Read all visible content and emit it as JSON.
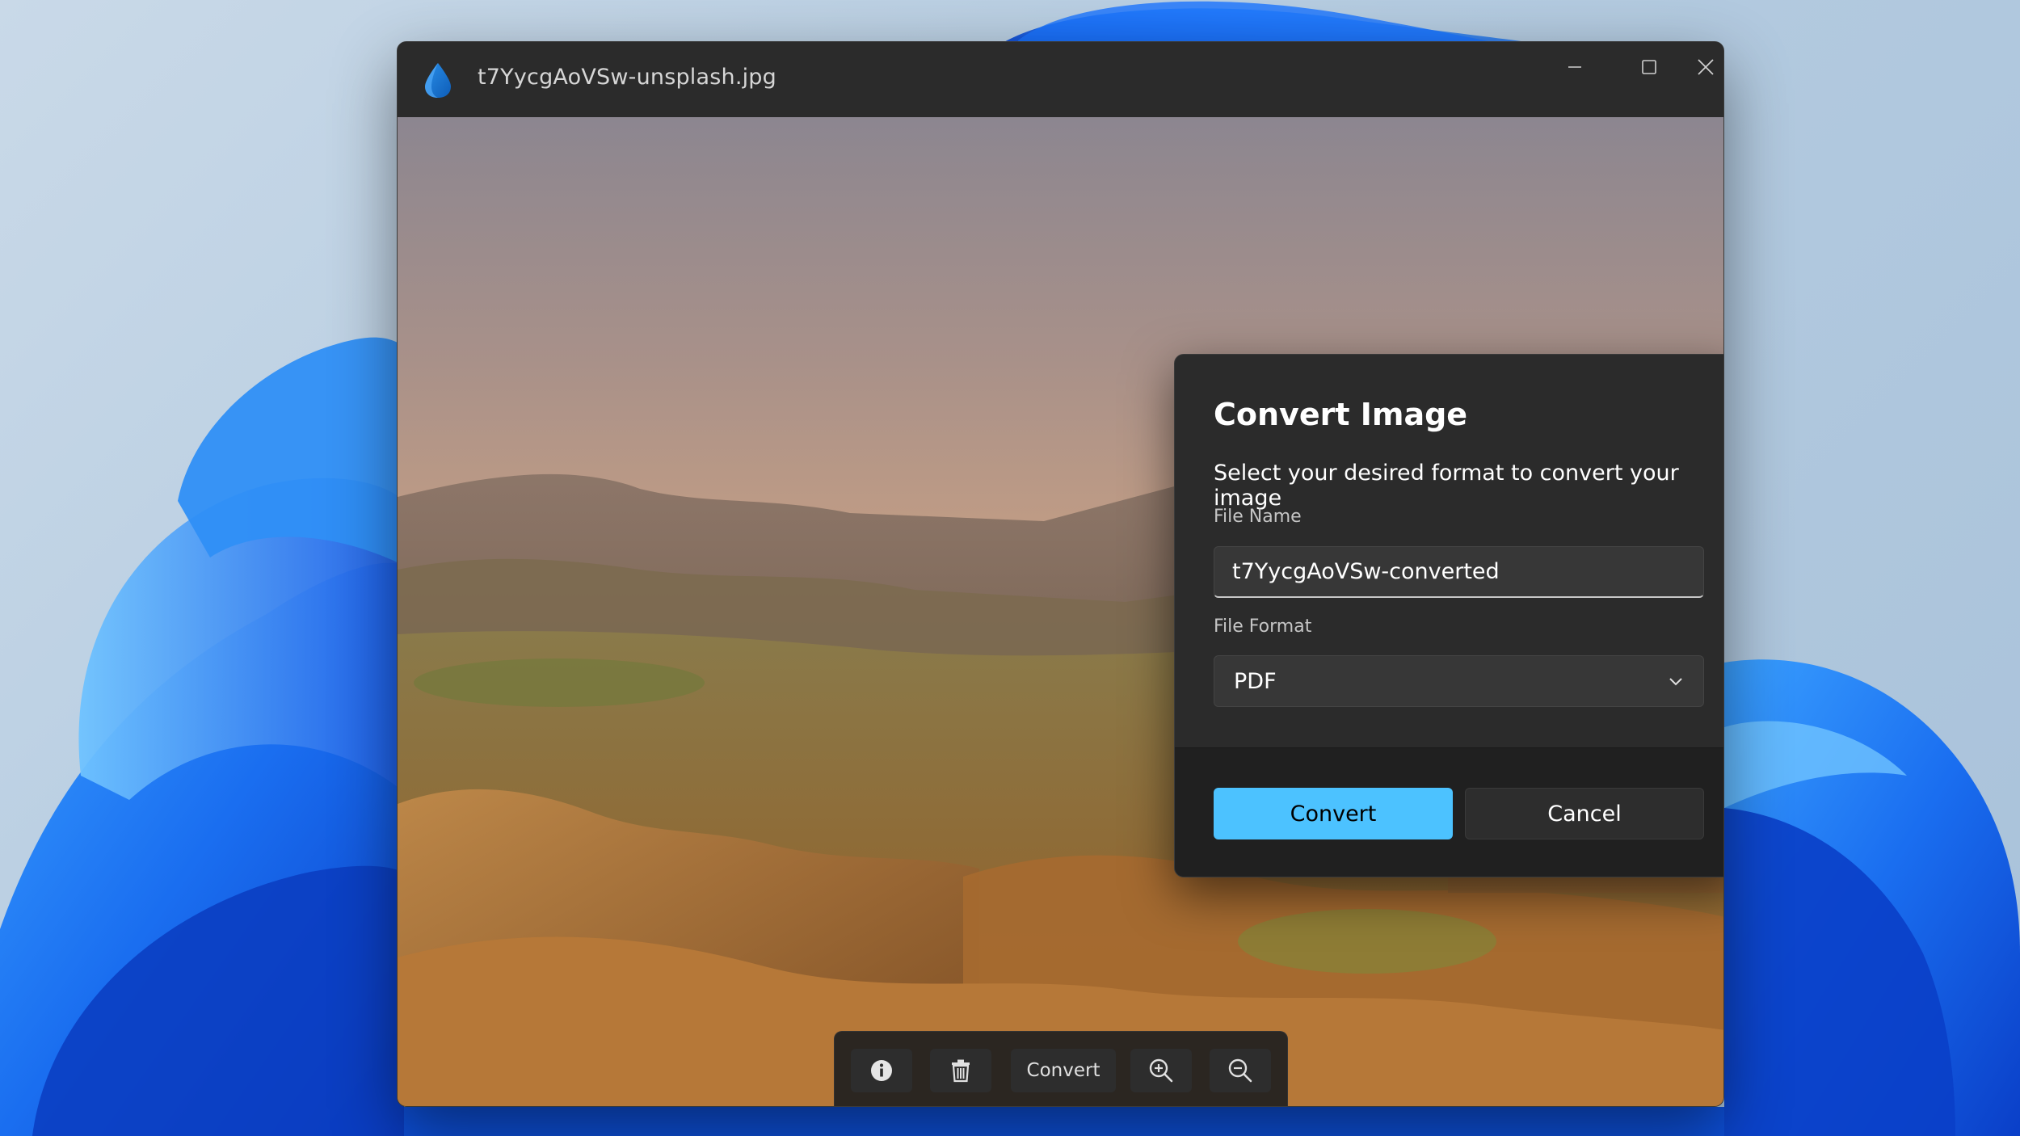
{
  "window": {
    "title": "t7YycgAoVSw-unsplash.jpg",
    "controls": {
      "minimize": "minimize-icon",
      "maximize": "maximize-icon",
      "close": "close-icon"
    }
  },
  "dialog": {
    "title": "Convert Image",
    "subtitle": "Select your desired format to convert your image",
    "file_name_label": "File Name",
    "file_name_value": "t7YycgAoVSw-converted",
    "file_format_label": "File Format",
    "file_format_value": "PDF",
    "convert_label": "Convert",
    "cancel_label": "Cancel"
  },
  "toolbar": {
    "info_icon": "info-icon",
    "delete_icon": "trash-icon",
    "convert_label": "Convert",
    "zoom_in_icon": "zoom-in-icon",
    "zoom_out_icon": "zoom-out-icon"
  },
  "colors": {
    "accent": "#4cc2ff",
    "dialog_bg": "#2b2b2b",
    "footer_bg": "#202020",
    "titlebar_bg": "#2b2b2b"
  }
}
